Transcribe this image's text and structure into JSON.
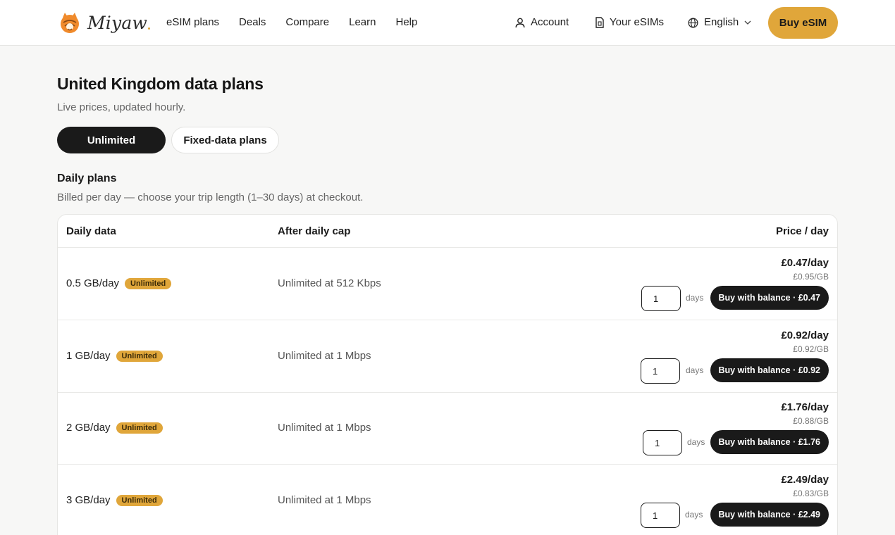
{
  "header": {
    "brand": "Miyaw",
    "nav": [
      "eSIM plans",
      "Deals",
      "Compare",
      "Learn",
      "Help"
    ],
    "account_label": "Account",
    "esims_label": "Your eSIMs",
    "language_label": "English",
    "buy_label": "Buy eSIM",
    "accent_color": "#e0a63a"
  },
  "page": {
    "title": "United Kingdom data plans",
    "subtitle": "Live prices, updated hourly.",
    "toggle": {
      "active": "Unlimited",
      "inactive": "Fixed-data plans"
    },
    "section_title": "Daily plans",
    "section_subtitle": "Billed per day — choose your trip length (1–30 days) at checkout."
  },
  "table": {
    "columns": [
      "Daily data",
      "After daily cap",
      "Price / day"
    ],
    "rows": [
      {
        "data": "0.5 GB/day",
        "badge": "Unlimited",
        "after_cap": "Unlimited at 512 Kbps",
        "price": "£0.47/day",
        "per_gb": "£0.95/GB",
        "qty": "1",
        "days_label": "days",
        "buy_label": "Buy with balance · £0.47"
      },
      {
        "data": "1 GB/day",
        "badge": "Unlimited",
        "after_cap": "Unlimited at 1 Mbps",
        "price": "£0.92/day",
        "per_gb": "£0.92/GB",
        "qty": "1",
        "days_label": "days",
        "buy_label": "Buy with balance · £0.92"
      },
      {
        "data": "2 GB/day",
        "badge": "Unlimited",
        "after_cap": "Unlimited at 1 Mbps",
        "price": "£1.76/day",
        "per_gb": "£0.88/GB",
        "qty": "1",
        "days_label": "days",
        "buy_label": "Buy with balance · £1.76"
      },
      {
        "data": "3 GB/day",
        "badge": "Unlimited",
        "after_cap": "Unlimited at 1 Mbps",
        "price": "£2.49/day",
        "per_gb": "£0.83/GB",
        "qty": "1",
        "days_label": "days",
        "buy_label": "Buy with balance · £2.49"
      }
    ]
  }
}
